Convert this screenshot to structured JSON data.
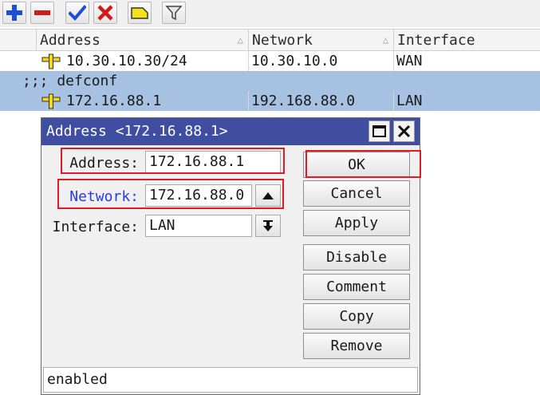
{
  "toolbar": {
    "buttons": [
      {
        "name": "add-button",
        "icon": "plus-icon",
        "color": "#1a4fd6"
      },
      {
        "name": "remove-button",
        "icon": "minus-icon",
        "color": "#d11a1a"
      },
      {
        "name": "enable-button",
        "icon": "checkmark-icon",
        "color": "#1a4fd6"
      },
      {
        "name": "disable-button",
        "icon": "x-icon",
        "color": "#d11a1a"
      },
      {
        "name": "comment-button",
        "icon": "note-icon",
        "color": "#f5e21a"
      },
      {
        "name": "filter-button",
        "icon": "filter-icon",
        "color": "#555555"
      }
    ]
  },
  "table": {
    "columns": [
      "Address",
      "Network",
      "Interface"
    ],
    "rows": [
      {
        "address": "10.30.10.30/24",
        "network": "10.30.10.0",
        "interface": "WAN",
        "selected": false
      },
      {
        "comment": ";;; defconf",
        "selected": true
      },
      {
        "address": "172.16.88.1",
        "network": "192.168.88.0",
        "interface": "LAN",
        "selected": true
      }
    ]
  },
  "dialog": {
    "title": "Address <172.16.88.1>",
    "address_label": "Address:",
    "address_value": "172.16.88.1",
    "network_label": "Network:",
    "network_value": "172.16.88.0",
    "interface_label": "Interface:",
    "interface_value": "LAN",
    "buttons": {
      "ok": "OK",
      "cancel": "Cancel",
      "apply": "Apply",
      "disable": "Disable",
      "comment": "Comment",
      "copy": "Copy",
      "remove": "Remove"
    },
    "status": "enabled"
  },
  "colors": {
    "selection": "#a7c1e3",
    "titlebar": "#3f4ea0",
    "highlight": "#e01b24",
    "network_label": "#2a3be0"
  }
}
